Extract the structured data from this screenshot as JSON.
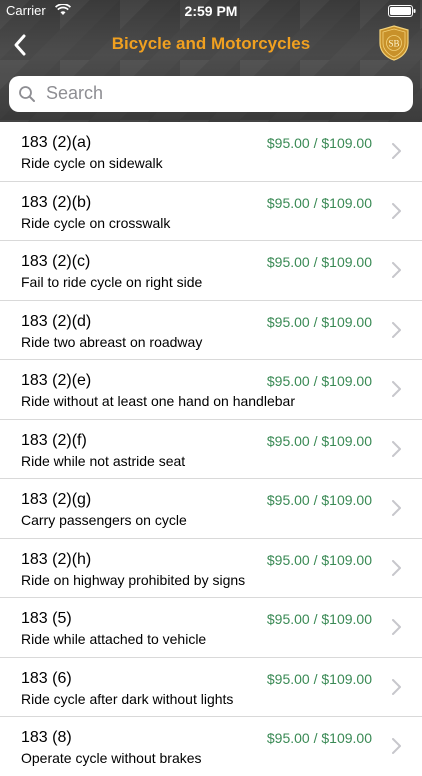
{
  "status_bar": {
    "carrier": "Carrier",
    "time": "2:59 PM"
  },
  "nav": {
    "title": "Bicycle and Motorcycles",
    "badge_text": "SB"
  },
  "search": {
    "placeholder": "Search"
  },
  "colors": {
    "title": "#f0a020",
    "price": "#3a8a55"
  },
  "items": [
    {
      "code": "183 (2)(a)",
      "description": "Ride cycle on sidewalk",
      "price": "$95.00 / $109.00"
    },
    {
      "code": "183 (2)(b)",
      "description": "Ride cycle on crosswalk",
      "price": "$95.00 / $109.00"
    },
    {
      "code": "183 (2)(c)",
      "description": "Fail to ride cycle on right side",
      "price": "$95.00 / $109.00"
    },
    {
      "code": "183 (2)(d)",
      "description": "Ride two abreast on roadway",
      "price": "$95.00 / $109.00"
    },
    {
      "code": "183 (2)(e)",
      "description": "Ride without at least one hand on handlebar",
      "price": "$95.00 / $109.00"
    },
    {
      "code": "183 (2)(f)",
      "description": "Ride while not astride seat",
      "price": "$95.00 / $109.00"
    },
    {
      "code": "183 (2)(g)",
      "description": "Carry passengers on cycle",
      "price": "$95.00 / $109.00"
    },
    {
      "code": "183 (2)(h)",
      "description": "Ride on highway prohibited by signs",
      "price": "$95.00 / $109.00"
    },
    {
      "code": "183 (5)",
      "description": "Ride while attached to vehicle",
      "price": "$95.00 / $109.00"
    },
    {
      "code": "183 (6)",
      "description": "Ride cycle after dark without lights",
      "price": "$95.00 / $109.00"
    },
    {
      "code": "183 (8)",
      "description": "Operate cycle without brakes",
      "price": "$95.00 / $109.00"
    }
  ]
}
